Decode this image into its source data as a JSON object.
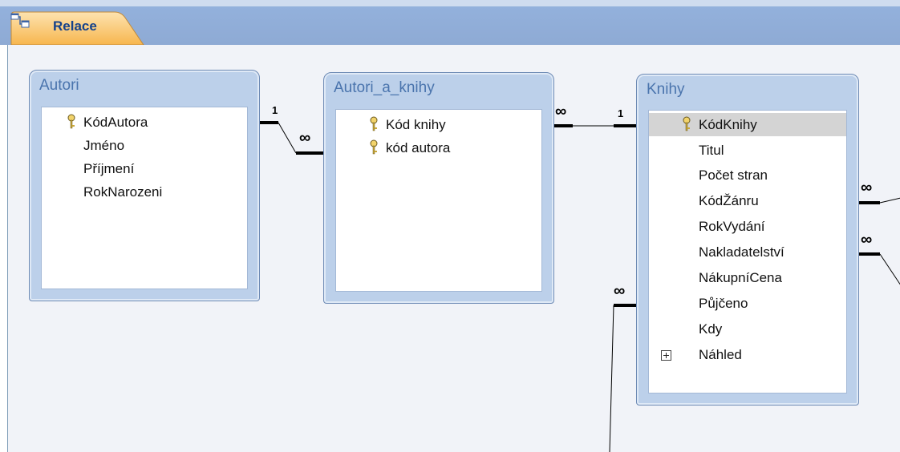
{
  "tab": {
    "label": "Relace",
    "icon": "relationships-icon"
  },
  "tables": [
    {
      "name": "Autori",
      "fields": [
        {
          "name": "KódAutora",
          "key": true
        },
        {
          "name": "Jméno",
          "key": false
        },
        {
          "name": "Příjmení",
          "key": false
        },
        {
          "name": "RokNarozeni",
          "key": false
        }
      ]
    },
    {
      "name": "Autori_a_knihy",
      "fields": [
        {
          "name": "Kód knihy",
          "key": true
        },
        {
          "name": "kód autora",
          "key": true
        }
      ]
    },
    {
      "name": "Knihy",
      "fields": [
        {
          "name": "KódKnihy",
          "key": true,
          "selected": true
        },
        {
          "name": "Titul",
          "key": false
        },
        {
          "name": "Počet stran",
          "key": false
        },
        {
          "name": "KódŽánru",
          "key": false
        },
        {
          "name": "RokVydání",
          "key": false
        },
        {
          "name": "Nakladatelství",
          "key": false
        },
        {
          "name": "NákupníCena",
          "key": false
        },
        {
          "name": "Půjčeno",
          "key": false
        },
        {
          "name": "Kdy",
          "key": false
        },
        {
          "name": "Náhled",
          "key": false,
          "expandable": true
        }
      ]
    }
  ],
  "cardinality": {
    "one": "1",
    "many": "∞"
  },
  "colors": {
    "tab_bg": "#f9c97c",
    "header_band": "#8eaad4",
    "canvas": "#f1f3f8",
    "table_frame": "#bcd0ea",
    "selected_row": "#d4d4d4"
  }
}
